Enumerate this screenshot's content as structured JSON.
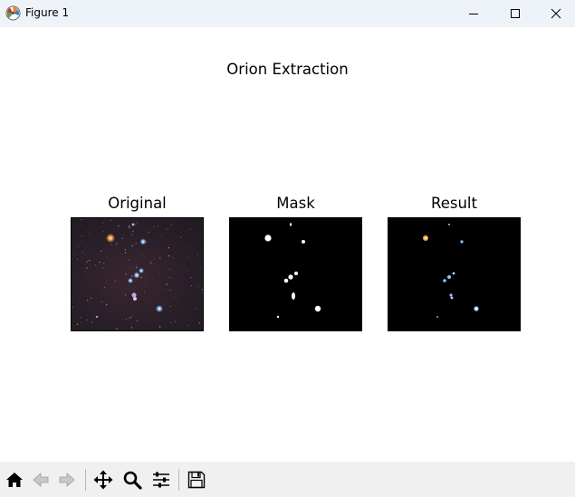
{
  "window": {
    "title": "Figure 1",
    "controls": {
      "minimize": "minimize-icon",
      "maximize": "maximize-icon",
      "close": "close-icon"
    }
  },
  "figure": {
    "suptitle": "Orion Extraction",
    "background": "#ffffff",
    "panels": [
      {
        "id": "original",
        "title": "Original",
        "image": "orion-starfield-photo"
      },
      {
        "id": "mask",
        "title": "Mask",
        "image": "binary-star-mask"
      },
      {
        "id": "result",
        "title": "Result",
        "image": "extracted-stars"
      }
    ]
  },
  "toolbar": {
    "tools": [
      "home-icon",
      "back-arrow-icon",
      "forward-arrow-icon",
      "pan-icon",
      "zoom-icon",
      "configure-subplots-icon",
      "save-icon"
    ]
  }
}
